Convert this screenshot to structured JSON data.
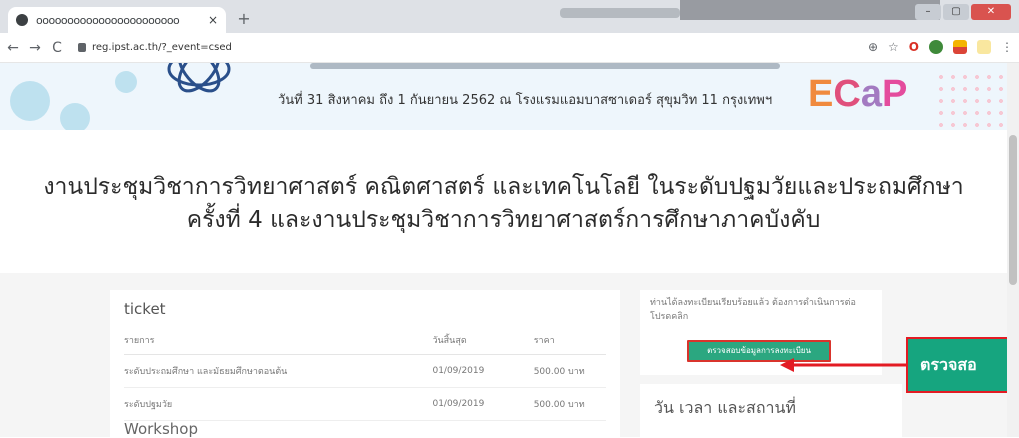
{
  "browser": {
    "tab_title": "ooooooooooooooooooooooo",
    "tab_close": "×",
    "new_tab": "+",
    "url": "reg.ipst.ac.th/?_event=csed",
    "window_buttons": [
      "–",
      "▢",
      "✕"
    ]
  },
  "banner": {
    "subtitle": "วันที่ 31 สิงหาคม ถึง 1 กันยายน 2562 ณ โรงแรมแอมบาสซาเดอร์ สุขุมวิท 11 กรุงเทพฯ",
    "logo": {
      "e": "E",
      "c": "C",
      "a": "a",
      "p": "P"
    }
  },
  "headline": {
    "line1": "งานประชุมวิชาการวิทยาศาสตร์ คณิตศาสตร์ และเทคโนโลยี ในระดับปฐมวัยและประถมศึกษา",
    "line2": "ครั้งที่ 4 และงานประชุมวิชาการวิทยาศาสตร์การศึกษาภาคบังคับ"
  },
  "ticket": {
    "title": "ticket",
    "headers": [
      "รายการ",
      "วันสิ้นสุด",
      "ราคา"
    ],
    "rows": [
      [
        "ระดับประถมศึกษา และมัธยมศึกษาตอนต้น",
        "01/09/2019",
        "500.00 บาท"
      ],
      [
        "ระดับปฐมวัย",
        "01/09/2019",
        "500.00 บาท"
      ]
    ],
    "workshop": "Workshop"
  },
  "side": {
    "note": "ท่านได้ลงทะเบียนเรียบร้อยแล้ว ต้องการดำเนินการต่อ โปรดคลิก",
    "button": "ตรวจสอบข้อมูลการลงทะเบียน",
    "section2_title": "วัน เวลา และสถานที่"
  },
  "callout": {
    "label": "ตรวจสอ"
  },
  "colors": {
    "accent_button": "#2ba780",
    "callout_bg": "#16a57f",
    "callout_border": "#e31b23"
  }
}
